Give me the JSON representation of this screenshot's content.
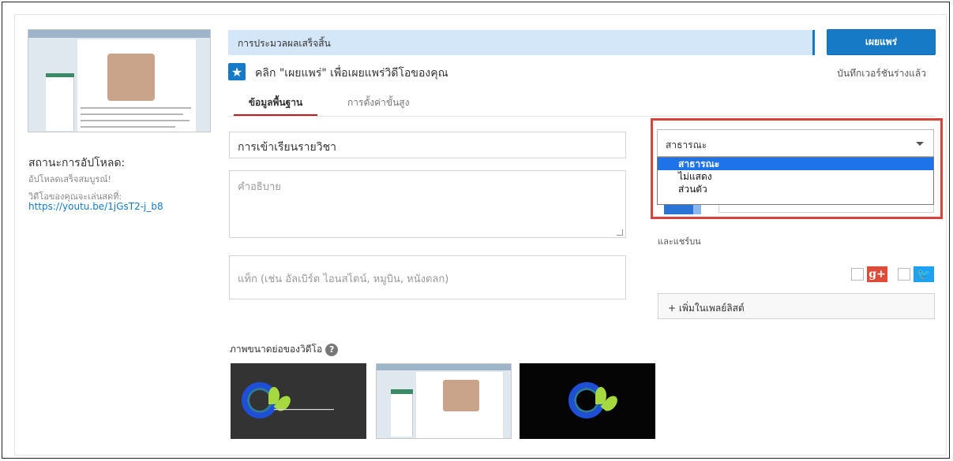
{
  "left": {
    "status_title": "สถานะการอัปโหลด:",
    "upload_done": "อัปโหลดเสร็จสมบูรณ์!",
    "live_at": "วิดีโอของคุณจะเล่นสดที่:",
    "video_url": "https://youtu.be/1jGsT2-j_b8"
  },
  "header": {
    "progress_text": "การประมวลผลเสร็จสิ้น",
    "publish_button": "เผยแพร่",
    "draft_saved": "บันทึกเวอร์ชันร่างแล้ว",
    "publish_hint": "คลิก \"เผยแพร่\" เพื่อเผยแพร่วิดีโอของคุณ"
  },
  "tabs": [
    {
      "label": "ข้อมูลพื้นฐาน",
      "active": true
    },
    {
      "label": "การตั้งค่าขั้นสูง",
      "active": false
    }
  ],
  "form": {
    "title_value": "การเข้าเรียนรายวิชา",
    "description_placeholder": "คำอธิบาย",
    "tags_placeholder": "แท็ก (เช่น อัลเบิร์ต ไอนสไตน์, หมูบิน, หนังตลก)",
    "thumbnails_label": "ภาพขนาดย่อของวิดีโอ",
    "help_glyph": "?"
  },
  "privacy": {
    "selected": "สาธารณะ",
    "options": [
      "สาธารณะ",
      "ไม่แสดง",
      "ส่วนตัว"
    ],
    "highlight_color": "#d9423a"
  },
  "share": {
    "label": "และแชร์บน",
    "gplus_glyph": "g+",
    "twitter_glyph": "🐦"
  },
  "playlist": {
    "button_label": "+ เพิ่มในเพลย์ลิสต์"
  },
  "colors": {
    "accent": "#167ac6",
    "progress_bg": "#d4e7f9",
    "active_tab": "#cc181e"
  }
}
